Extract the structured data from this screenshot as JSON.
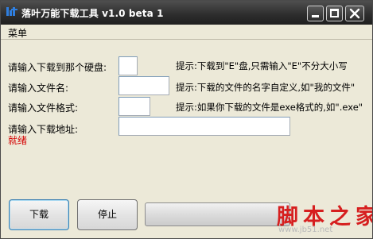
{
  "window": {
    "title": "落叶万能下载工具 v1.0 beta 1"
  },
  "menubar": {
    "menu_label": "菜单"
  },
  "form": {
    "disk": {
      "label": "请输入下载到那个硬盘:",
      "value": "",
      "hint": "提示:下载到\"E\"盘,只需输入\"E\"不分大小写"
    },
    "filename": {
      "label": "请输入文件名:",
      "value": "",
      "hint": "提示:下载的文件的名字自定义,如\"我的文件\""
    },
    "format": {
      "label": "请输入文件格式:",
      "value": "",
      "hint": "提示:如果你下载的文件是exe格式的,如\".exe\""
    },
    "url": {
      "label": "请输入下载地址:",
      "value": ""
    }
  },
  "status": {
    "text": "就绪",
    "color": "#d40000"
  },
  "buttons": {
    "download_label": "下载",
    "stop_label": "停止"
  },
  "progress": {
    "percent": 0
  },
  "watermark": {
    "main": "脚本之家",
    "sub": "www.jb51.net"
  }
}
